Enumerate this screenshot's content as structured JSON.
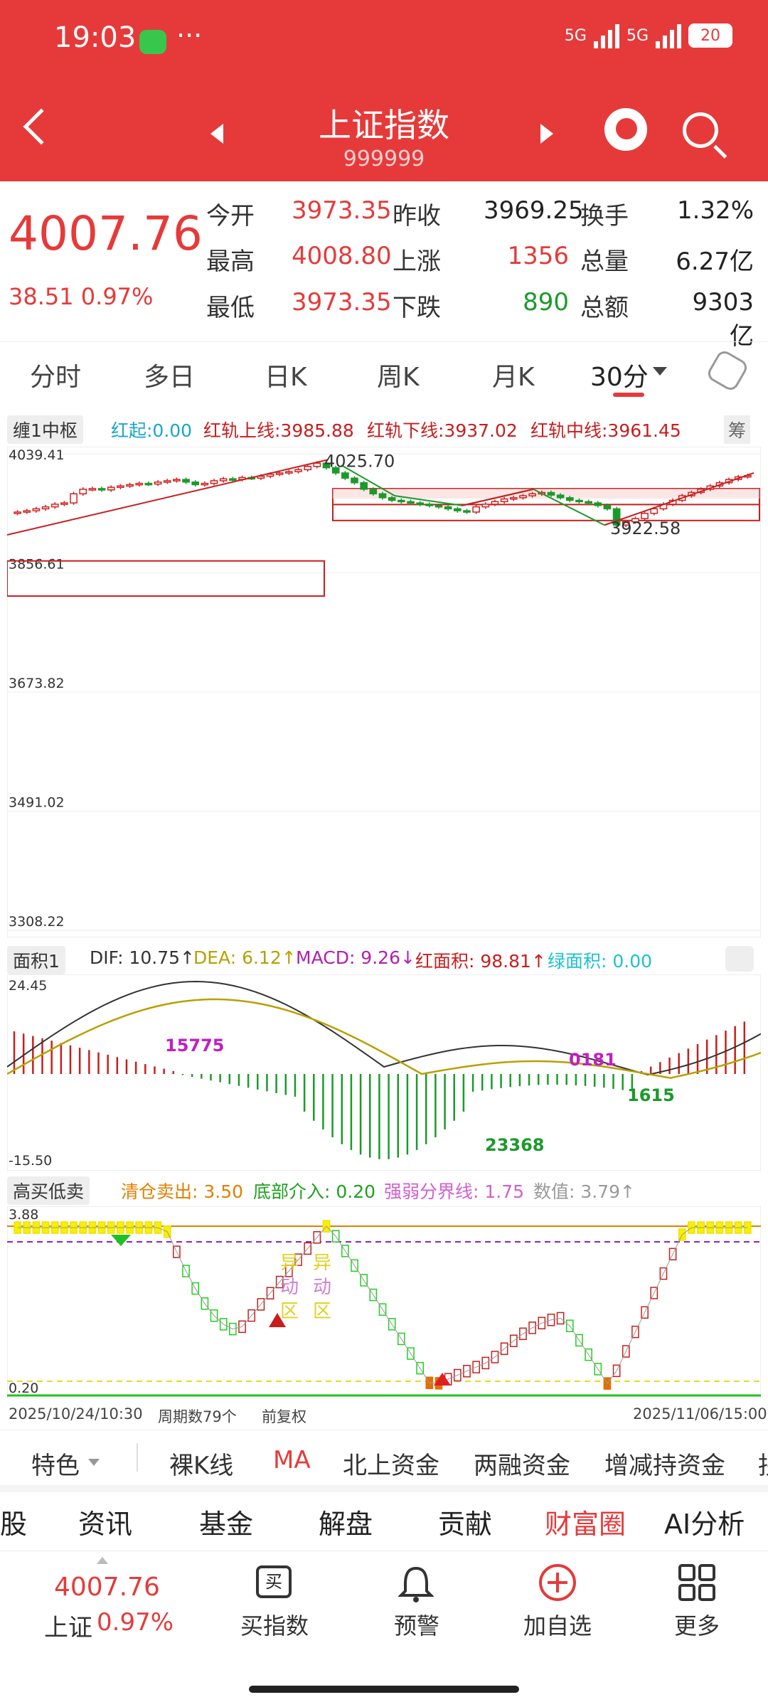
{
  "status": {
    "time": "19:03",
    "net1": "5G",
    "net2": "5G",
    "battery": "20"
  },
  "header": {
    "title": "上证指数",
    "code": "999999"
  },
  "quote": {
    "price": "4007.76",
    "change": "38.51 0.97%",
    "rows": [
      [
        {
          "label": "今开",
          "value": "3973.35",
          "c": "red"
        },
        {
          "label": "昨收",
          "value": "3969.25",
          "c": "blk"
        },
        {
          "label": "换手",
          "value": "1.32%",
          "c": "blk"
        }
      ],
      [
        {
          "label": "最高",
          "value": "4008.80",
          "c": "red"
        },
        {
          "label": "上涨",
          "value": "1356",
          "c": "red"
        },
        {
          "label": "总量",
          "value": "6.27亿",
          "c": "blk"
        }
      ],
      [
        {
          "label": "最低",
          "value": "3973.35",
          "c": "red"
        },
        {
          "label": "下跌",
          "value": "890",
          "c": "green"
        },
        {
          "label": "总额",
          "value": "9303亿",
          "c": "blk"
        }
      ]
    ]
  },
  "tabs": [
    "分时",
    "多日",
    "日K",
    "周K",
    "月K",
    "30分"
  ],
  "indicator1": {
    "selector": "缠1中枢",
    "items": [
      {
        "text": "红起:0.00",
        "color": "#18a7c9"
      },
      {
        "text": "红轨上线:3985.88",
        "color": "#c81e1e"
      },
      {
        "text": "红轨下线:3937.02",
        "color": "#c81e1e"
      },
      {
        "text": "红轨中线:3961.45",
        "color": "#c81e1e"
      }
    ],
    "corner": "筹"
  },
  "indicator2": {
    "selector": "面积1",
    "items": [
      {
        "text": "DIF: 10.75↑",
        "color": "#333"
      },
      {
        "text": "DEA: 6.12↑",
        "color": "#b8a000"
      },
      {
        "text": "MACD: 9.26↓",
        "color": "#b020b0"
      },
      {
        "text": "红面积: 98.81↑",
        "color": "#c81e1e"
      },
      {
        "text": "绿面积: 0.00",
        "color": "#20c0d0"
      }
    ]
  },
  "indicator3": {
    "selector": "高买低卖",
    "items": [
      {
        "text": "清仓卖出: 3.50",
        "color": "#e08000"
      },
      {
        "text": "底部介入: 0.20",
        "color": "#20a020"
      },
      {
        "text": "强弱分界线: 1.75",
        "color": "#d060d0"
      },
      {
        "text": "数值: 3.79↑",
        "color": "#999"
      }
    ]
  },
  "chart_data": [
    {
      "type": "candlestick",
      "yticks": [
        "4039.41",
        "3856.61",
        "3673.82",
        "3491.02",
        "3308.22"
      ],
      "ylim": [
        3308.22,
        4039.41
      ],
      "annotations": [
        "4025.70",
        "3922.58"
      ],
      "close_series": [
        3950,
        3952,
        3955,
        3958,
        3962,
        3964,
        3978,
        3985,
        3986,
        3984,
        3988,
        3990,
        3992,
        3994,
        3993,
        3996,
        3998,
        4000,
        3996,
        3992,
        3994,
        3998,
        4001,
        4000,
        4003,
        4002,
        4005,
        4008,
        4010,
        4012,
        4015,
        4020,
        4025,
        4018,
        4010,
        4002,
        3995,
        3985,
        3978,
        3972,
        3968,
        3966,
        3964,
        3962,
        3960,
        3958,
        3955,
        3952,
        3950,
        3958,
        3962,
        3966,
        3970,
        3972,
        3975,
        3978,
        3980,
        3976,
        3972,
        3968,
        3966,
        3964,
        3960,
        3955,
        3930,
        3935,
        3940,
        3948,
        3955,
        3962,
        3968,
        3975,
        3980,
        3985,
        3990,
        3995,
        4000,
        4004,
        4006
      ]
    },
    {
      "type": "bar",
      "yticks": [
        "24.45",
        "-15.50"
      ],
      "annotations": [
        "15775",
        "23368",
        "0181",
        "1615"
      ]
    },
    {
      "type": "line",
      "yticks": [
        "3.88",
        "0.20"
      ],
      "annotations": [
        "异",
        "动",
        "区",
        "异",
        "动",
        "区"
      ],
      "xlabels": [
        "2025/10/24/10:30",
        "周期数79个",
        "前复权",
        "2025/11/06/15:00"
      ]
    }
  ],
  "bottom_tabs": [
    "特色",
    "裸K线",
    "MA",
    "北上资金",
    "两融资金",
    "增减持资金",
    "拐"
  ],
  "categories": [
    "股",
    "资讯",
    "基金",
    "解盘",
    "贡献",
    "财富圈",
    "AI分析"
  ],
  "toolbar": {
    "price": "4007.76",
    "name": "上证",
    "pct": "0.97%",
    "b1": "买指数",
    "b1_icon": "买",
    "b2": "预警",
    "b3": "加自选",
    "b4": "更多"
  }
}
